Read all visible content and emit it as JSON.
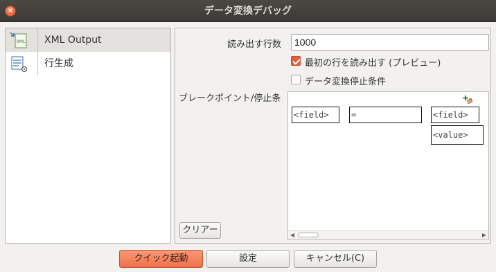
{
  "window": {
    "title": "データ変換デバッグ",
    "close_glyph": "×"
  },
  "sidebar": {
    "items": [
      {
        "label": "XML Output",
        "icon": "xml-file-icon",
        "selected": true
      },
      {
        "label": "行生成",
        "icon": "row-generator-icon",
        "selected": false
      }
    ]
  },
  "panel": {
    "rows_label": "読み出す行数",
    "rows_value": "1000",
    "preview_label": "最初の行を読み出す (プレビュー)",
    "preview_checked": true,
    "stop_label": "データ変換停止条件",
    "stop_checked": false,
    "breakpoint_label": "ブレークポイント/停止条",
    "clear_label": "クリアー",
    "condition": {
      "left_field": "<field>",
      "operator": "=",
      "right_field": "<field>",
      "value": "<value>"
    }
  },
  "footer": {
    "quick_launch": "クイック起動",
    "settings": "設定",
    "cancel": "キャンセル(C)"
  },
  "colors": {
    "accent": "#ee7049",
    "titlebar": "#3b3a36"
  }
}
